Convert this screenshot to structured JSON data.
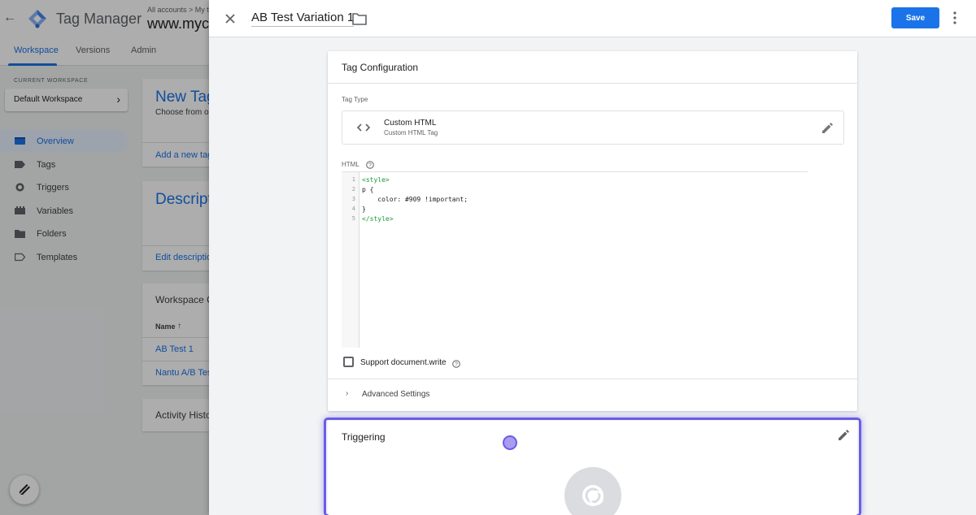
{
  "app": {
    "product_name": "Tag Manager",
    "breadcrumbs": "All accounts  >  My t",
    "container_name": "www.myco"
  },
  "tabs": [
    {
      "label": "Workspace",
      "active": true
    },
    {
      "label": "Versions",
      "active": false
    },
    {
      "label": "Admin",
      "active": false
    }
  ],
  "sidebar": {
    "workspace_label": "CURRENT WORKSPACE",
    "workspace_name": "Default Workspace",
    "items": [
      {
        "label": "Overview",
        "icon": "overview-icon",
        "active": true
      },
      {
        "label": "Tags",
        "icon": "tag-icon",
        "active": false
      },
      {
        "label": "Triggers",
        "icon": "trigger-icon",
        "active": false
      },
      {
        "label": "Variables",
        "icon": "variables-icon",
        "active": false
      },
      {
        "label": "Folders",
        "icon": "folder-icon",
        "active": false
      },
      {
        "label": "Templates",
        "icon": "templates-icon",
        "active": false
      }
    ]
  },
  "background_cards": {
    "new_tag_title": "New Tag",
    "new_tag_desc": "Choose from o",
    "add_tag_link": "Add a new tag",
    "description_title": "Descript",
    "edit_description_link": "Edit descriptio",
    "workspace_changes_title": "Workspace C",
    "name_header": "Name",
    "rows": [
      "AB Test 1",
      "Nantu A/B Tes"
    ],
    "activity_title": "Activity Histo"
  },
  "sheet": {
    "tag_name": "AB Test Variation 1",
    "save_label": "Save"
  },
  "tag_configuration": {
    "title": "Tag Configuration",
    "tag_type_label": "Tag Type",
    "tag_type_name": "Custom HTML",
    "tag_type_desc": "Custom HTML Tag",
    "html_label": "HTML",
    "code_lines": [
      {
        "num": "1",
        "text": "<style>",
        "color": "#1a9a3a"
      },
      {
        "num": "2",
        "text": "p {",
        "color": "#202124"
      },
      {
        "num": "3",
        "text": "    color: #909 !important;",
        "color": "#202124"
      },
      {
        "num": "4",
        "text": "}",
        "color": "#202124"
      },
      {
        "num": "5",
        "text": "</style>",
        "color": "#1a9a3a"
      }
    ],
    "support_document_write": "Support document.write",
    "support_checked": false,
    "advanced_settings": "Advanced Settings"
  },
  "triggering": {
    "title": "Triggering"
  },
  "colors": {
    "accent": "#1a73e8",
    "focus_ring": "#6a5ce8"
  }
}
